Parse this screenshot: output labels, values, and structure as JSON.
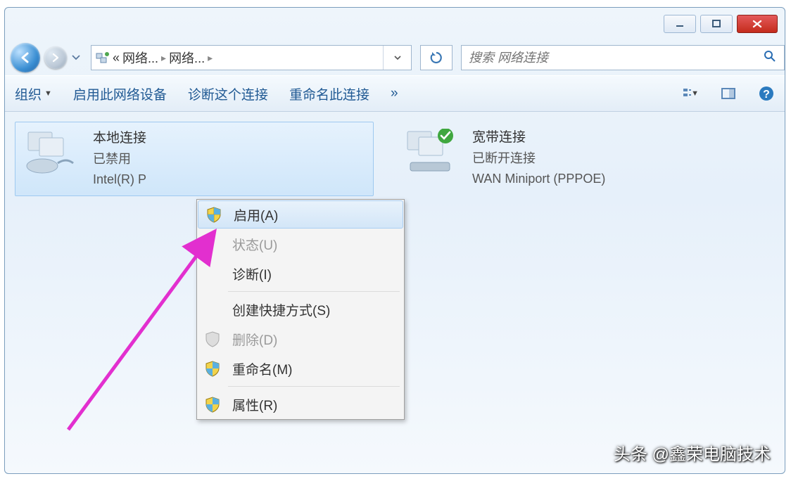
{
  "titlebar": {},
  "breadcrumbs": {
    "chevrons": "«",
    "seg1": "网络...",
    "seg2": "网络..."
  },
  "search": {
    "placeholder": "搜索 网络连接"
  },
  "toolbar": {
    "organize": "组织",
    "enable_device": "启用此网络设备",
    "diagnose": "诊断这个连接",
    "rename": "重命名此连接",
    "more": "»"
  },
  "connections": {
    "local": {
      "title": "本地连接",
      "status": "已禁用",
      "device": "Intel(R) P"
    },
    "broadband": {
      "title": "宽带连接",
      "status": "已断开连接",
      "device": "WAN Miniport (PPPOE)"
    }
  },
  "context_menu": {
    "enable": "启用(A)",
    "status": "状态(U)",
    "diagnose": "诊断(I)",
    "shortcut": "创建快捷方式(S)",
    "delete": "删除(D)",
    "rename": "重命名(M)",
    "properties": "属性(R)"
  },
  "watermark": "头条 @鑫荣电脑技术"
}
